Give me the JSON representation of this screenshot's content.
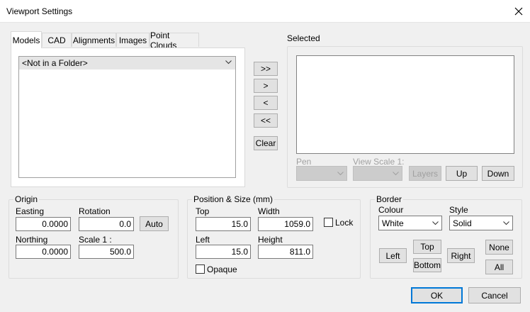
{
  "window": {
    "title": "Viewport Settings"
  },
  "tabs": [
    "Models",
    "CAD",
    "Alignments",
    "Images",
    "Point Clouds"
  ],
  "folder_select": {
    "value": "<Not in a Folder>"
  },
  "transfer": {
    "add_all": ">>",
    "add": ">",
    "remove": "<",
    "remove_all": "<<",
    "clear": "Clear"
  },
  "selected": {
    "label": "Selected",
    "pen_label": "Pen",
    "view_scale_label": "View Scale 1:",
    "layers": "Layers",
    "up": "Up",
    "down": "Down"
  },
  "origin": {
    "label": "Origin",
    "easting_label": "Easting",
    "easting": "0.0000",
    "rotation_label": "Rotation",
    "rotation": "0.0",
    "auto": "Auto",
    "northing_label": "Northing",
    "northing": "0.0000",
    "scale_label": "Scale 1 :",
    "scale": "500.0"
  },
  "position": {
    "label": "Position & Size (mm)",
    "top_label": "Top",
    "top": "15.0",
    "width_label": "Width",
    "width": "1059.0",
    "lock": "Lock",
    "left_label": "Left",
    "left": "15.0",
    "height_label": "Height",
    "height": "811.0",
    "opaque": "Opaque"
  },
  "border": {
    "label": "Border",
    "colour_label": "Colour",
    "colour": "White",
    "style_label": "Style",
    "style": "Solid",
    "left": "Left",
    "top": "Top",
    "bottom": "Bottom",
    "right": "Right",
    "none": "None",
    "all": "All"
  },
  "footer": {
    "ok": "OK",
    "cancel": "Cancel"
  }
}
